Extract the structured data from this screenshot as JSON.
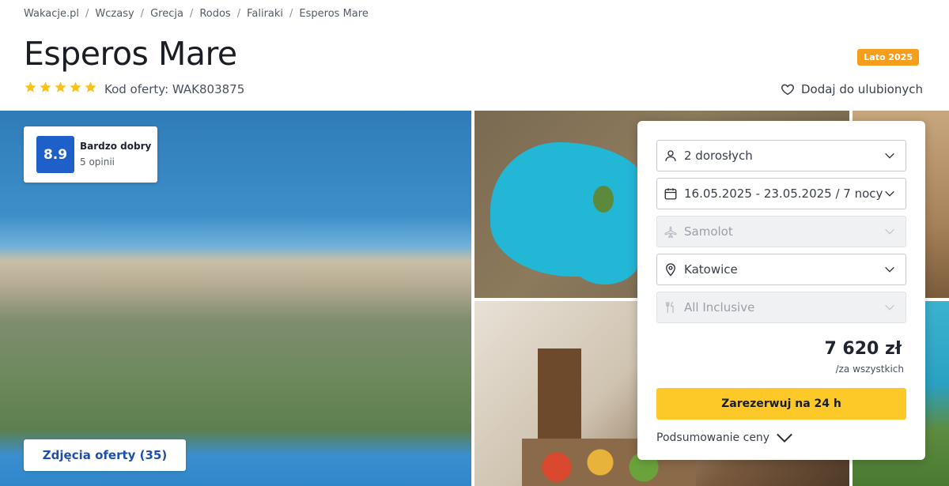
{
  "breadcrumb": [
    "Wakacje.pl",
    "Wczasy",
    "Grecja",
    "Rodos",
    "Faliraki",
    "Esperos Mare"
  ],
  "breadcrumb_separator": "/",
  "hotel": {
    "name": "Esperos Mare",
    "stars": 5,
    "offer_code": "Kod oferty: WAK803875"
  },
  "season_badge": "Lato 2025",
  "favorite_label": "Dodaj do ulubionych",
  "rating": {
    "score": "8.9",
    "label": "Bardzo dobry",
    "reviews": "5 opinii"
  },
  "photos_button": "Zdjęcia oferty (35)",
  "booking": {
    "travelers": "2 dorosłych",
    "dates": "16.05.2025 - 23.05.2025 / 7 nocy",
    "transport": "Samolot",
    "departure": "Katowice",
    "board": "All Inclusive",
    "price": "7 620 zł",
    "price_note": "/za wszystkich",
    "cta": "Zarezerwuj na 24 h",
    "summary": "Podsumowanie ceny"
  },
  "icons": {
    "star": "star-icon",
    "heart": "heart-icon",
    "person": "person-icon",
    "calendar": "calendar-icon",
    "plane": "plane-icon",
    "pin": "map-pin-icon",
    "dining": "cutlery-icon",
    "chevron": "chevron-down-icon"
  },
  "colors": {
    "accent_yellow": "#fcc928",
    "badge_orange": "#f59e1c",
    "rating_blue": "#1f5fc9",
    "link_blue": "#1f4fae",
    "star_yellow": "#f8c21b"
  }
}
